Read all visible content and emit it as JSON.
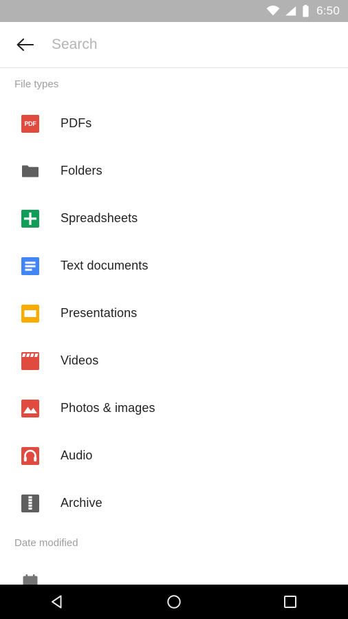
{
  "statusbar": {
    "time": "6:50",
    "icons": [
      "wifi-icon",
      "cell-signal-icon",
      "battery-icon"
    ],
    "background_color": "#b2b2b2",
    "foreground_color": "#ffffff"
  },
  "search": {
    "back_icon": "back-arrow-icon",
    "value": "",
    "placeholder": "Search"
  },
  "sections": [
    {
      "title": "File types"
    },
    {
      "title": "Date modified"
    }
  ],
  "file_types": [
    {
      "label": "PDFs",
      "icon": "pdf-file-icon",
      "color": "#e04a3f",
      "badge": "PDF"
    },
    {
      "label": "Folders",
      "icon": "folder-icon",
      "color": "#5f5f5f"
    },
    {
      "label": "Spreadsheets",
      "icon": "spreadsheet-icon",
      "color": "#0f9d58"
    },
    {
      "label": "Text documents",
      "icon": "text-document-icon",
      "color": "#4285f4"
    },
    {
      "label": "Presentations",
      "icon": "presentation-icon",
      "color": "#f9ab00"
    },
    {
      "label": "Videos",
      "icon": "video-clapperboard-icon",
      "color": "#e04a3f"
    },
    {
      "label": "Photos & images",
      "icon": "photo-image-icon",
      "color": "#e04a3f"
    },
    {
      "label": "Audio",
      "icon": "audio-headphones-icon",
      "color": "#e04a3f"
    },
    {
      "label": "Archive",
      "icon": "archive-zip-icon",
      "color": "#5f5f5f"
    }
  ],
  "date_modified": [
    {
      "label": "",
      "icon": "calendar-icon",
      "color": "#757575"
    }
  ],
  "navbar": {
    "back": "back-triangle-icon",
    "home": "home-circle-icon",
    "recents": "recents-square-icon",
    "background_color": "#000000"
  }
}
